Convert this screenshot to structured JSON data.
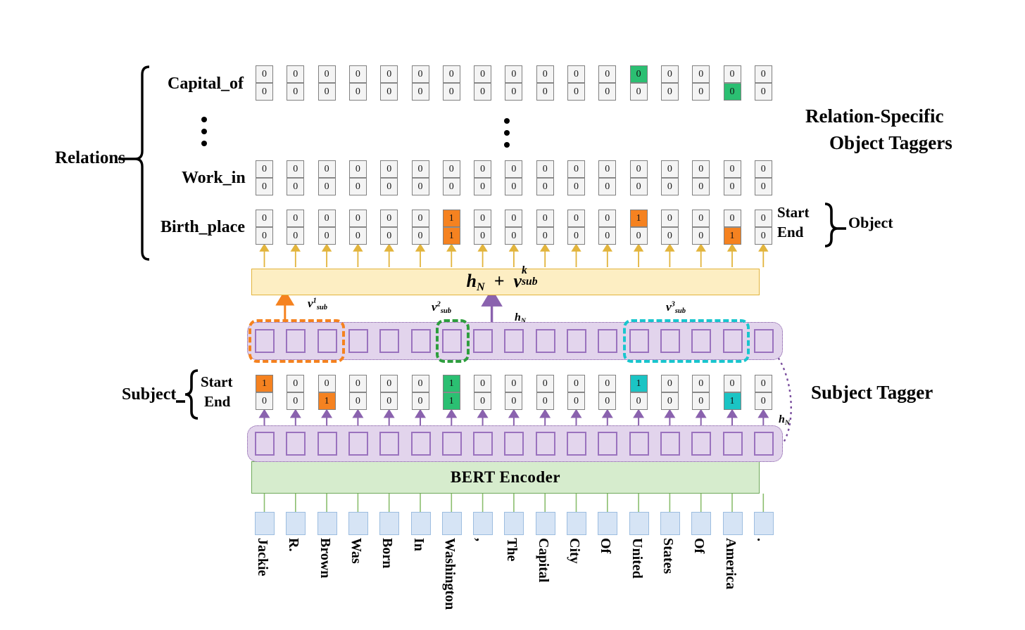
{
  "figure": {
    "title_right_top": "Relation-Specific\nObject Taggers",
    "title_right_top_line1": "Relation-Specific",
    "title_right_top_line2": "Object Taggers",
    "title_right_mid": "Subject Tagger",
    "encoder_label": "BERT Encoder",
    "fusion_label": "h_N + v^k_sub"
  },
  "labels": {
    "relations": "Relations",
    "subject": "Subject",
    "object": "Object",
    "start": "Start",
    "end": "End",
    "vdots": "⋮"
  },
  "relations": [
    {
      "name": "Capital_of",
      "accent": "#2BBF72"
    },
    {
      "name": "Work_in",
      "accent": "#808080"
    },
    {
      "name": "Birth_place",
      "accent": "#F58220"
    }
  ],
  "tokens": [
    "Jackie",
    "R.",
    "Brown",
    "Was",
    "Born",
    "In",
    "Washington",
    ",",
    "The",
    "Capital",
    "City",
    "Of",
    "United",
    "States",
    "Of",
    "America",
    "."
  ],
  "object_taggers": {
    "Capital_of": {
      "start": [
        "0",
        "0",
        "0",
        "0",
        "0",
        "0",
        "0",
        "0",
        "0",
        "0",
        "0",
        "0",
        "0",
        "0",
        "0",
        "0",
        "0"
      ],
      "end": [
        "0",
        "0",
        "0",
        "0",
        "0",
        "0",
        "0",
        "0",
        "0",
        "0",
        "0",
        "0",
        "0",
        "0",
        "0",
        "0",
        "0"
      ],
      "start_highlight": [
        12
      ],
      "end_highlight": [
        15
      ],
      "highlight_color": "#2BBF72"
    },
    "Work_in": {
      "start": [
        "0",
        "0",
        "0",
        "0",
        "0",
        "0",
        "0",
        "0",
        "0",
        "0",
        "0",
        "0",
        "0",
        "0",
        "0",
        "0",
        "0"
      ],
      "end": [
        "0",
        "0",
        "0",
        "0",
        "0",
        "0",
        "0",
        "0",
        "0",
        "0",
        "0",
        "0",
        "0",
        "0",
        "0",
        "0",
        "0"
      ],
      "start_highlight": [],
      "end_highlight": [],
      "highlight_color": "#808080"
    },
    "Birth_place": {
      "start": [
        "0",
        "0",
        "0",
        "0",
        "0",
        "0",
        "1",
        "0",
        "0",
        "0",
        "0",
        "0",
        "1",
        "0",
        "0",
        "0",
        "0"
      ],
      "end": [
        "0",
        "0",
        "0",
        "0",
        "0",
        "0",
        "1",
        "0",
        "0",
        "0",
        "0",
        "0",
        "0",
        "0",
        "0",
        "1",
        "0"
      ],
      "start_highlight": [
        6,
        12
      ],
      "end_highlight": [
        6,
        15
      ],
      "highlight_color": "#F58220"
    }
  },
  "subject_tagger": {
    "start": [
      "1",
      "0",
      "0",
      "0",
      "0",
      "0",
      "1",
      "0",
      "0",
      "0",
      "0",
      "0",
      "1",
      "0",
      "0",
      "0",
      "0"
    ],
    "end": [
      "0",
      "0",
      "1",
      "0",
      "0",
      "0",
      "1",
      "0",
      "0",
      "0",
      "0",
      "0",
      "0",
      "0",
      "0",
      "1",
      "0"
    ],
    "start_highlight_orange": [
      0
    ],
    "end_highlight_orange": [
      2
    ],
    "start_highlight_green": [
      6
    ],
    "end_highlight_green": [
      6
    ],
    "start_highlight_teal": [
      12
    ],
    "end_highlight_teal": [
      15
    ]
  },
  "subject_spans": [
    {
      "id": "v1",
      "label_base": "v",
      "label_sup": "1",
      "label_sub": "sub",
      "from_token": 0,
      "to_token": 2,
      "color": "#F5821F"
    },
    {
      "id": "v2",
      "label_base": "v",
      "label_sup": "2",
      "label_sub": "sub",
      "from_token": 6,
      "to_token": 6,
      "color": "#2E9E3E"
    },
    {
      "id": "v3",
      "label_base": "v",
      "label_sup": "3",
      "label_sub": "sub",
      "from_token": 12,
      "to_token": 15,
      "color": "#19C6CE"
    }
  ],
  "math_annotations": {
    "h_N_top": "h_N",
    "h_N_right": "h_N",
    "fusion_h": "h",
    "fusion_N": "N",
    "fusion_plus": "+",
    "fusion_v": "v",
    "fusion_k": "k",
    "fusion_sub": "sub"
  },
  "colors": {
    "orange": "#F58220",
    "green": "#2BBF72",
    "teal": "#1BC4C4",
    "purple_fill": "#E3D5ED",
    "purple_border": "#9A72BE",
    "purple_dotted": "#7A4E9E",
    "yellow_fill": "#FDEEC3",
    "yellow_border": "#E2B43C",
    "bert_fill": "#D6ECCD",
    "bert_border": "#6FA95A",
    "token_fill": "#D6E4F5",
    "token_border": "#9DBDE0",
    "cell_fill": "#F4F4F4",
    "cell_border": "#808080"
  }
}
